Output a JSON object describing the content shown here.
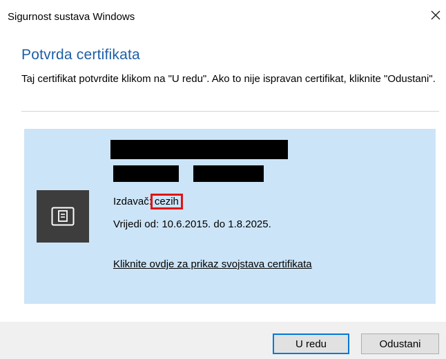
{
  "window": {
    "title": "Sigurnost sustava Windows",
    "close_glyph": "✕"
  },
  "dialog": {
    "heading": "Potvrda certifikata",
    "instruction": "Taj certifikat potvrdite klikom na \"U redu\". Ako to nije ispravan certifikat, kliknite \"Odustani\"."
  },
  "certificate": {
    "icon": "certificate-icon",
    "issuer_label": "Izdavač:",
    "issuer_value": "cezih",
    "validity": "Vrijedi od: 10.6.2015. do 1.8.2025.",
    "details_link": "Kliknite ovdje za prikaz svojstava certifikata"
  },
  "buttons": {
    "ok": "U redu",
    "cancel": "Odustani"
  },
  "colors": {
    "heading": "#1c5ea6",
    "card_background": "#cce4f7",
    "highlight_box": "#e01414",
    "ok_focus_border": "#0078d7"
  }
}
